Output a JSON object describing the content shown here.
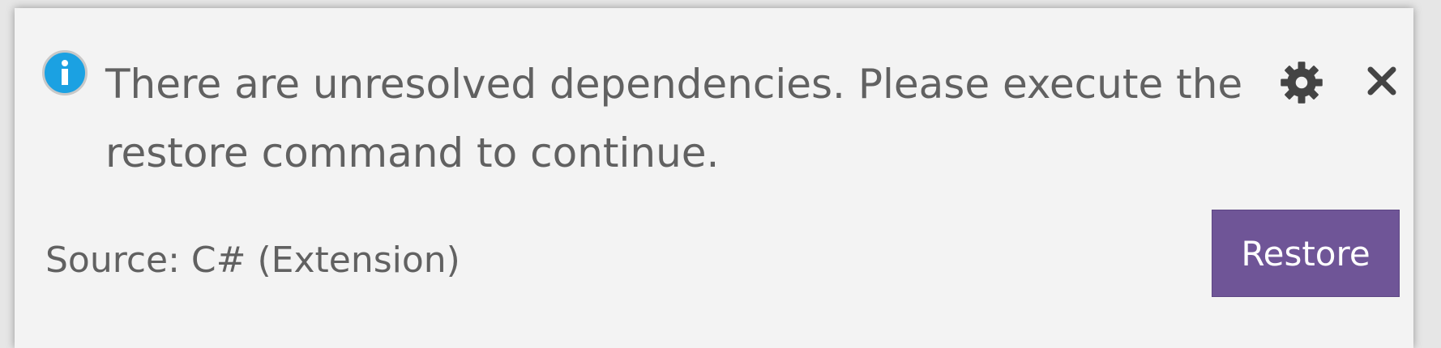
{
  "notification": {
    "icon": "info-icon",
    "message": "There are unresolved dependencies. Please execute the restore command to continue.",
    "source": "Source: C# (Extension)",
    "actions": {
      "settings_icon": "gear-icon",
      "close_icon": "close-icon",
      "restore_label": "Restore"
    }
  },
  "colors": {
    "background": "#f3f3f3",
    "text": "#616161",
    "info_icon": "#1ba1e2",
    "restore_button": "#6f5597",
    "icon_dark": "#444444"
  }
}
